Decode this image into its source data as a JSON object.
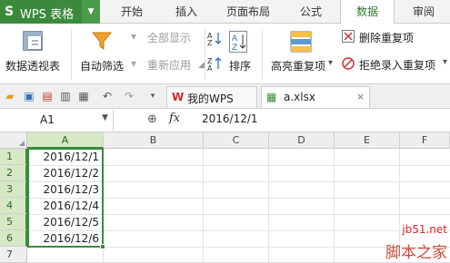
{
  "app": {
    "logo_glyph": "S",
    "name": "WPS 表格",
    "menu_caret": "▼"
  },
  "menu": {
    "tabs": [
      "开始",
      "插入",
      "页面布局",
      "公式",
      "数据",
      "审阅"
    ],
    "active_tab": "数据"
  },
  "ribbon": {
    "pivot_table": "数据透视表",
    "auto_filter": "自动筛选",
    "show_all": "全部显示",
    "reapply": "重新应用",
    "sort": "排序",
    "highlight_duplicates": "高亮重复项",
    "remove_duplicates": "删除重复项",
    "reject_duplicates": "拒绝录入重复项",
    "dropdown_caret": "▾"
  },
  "doc_tabs": [
    {
      "label": "我的WPS",
      "active": false
    },
    {
      "label": "a.xlsx",
      "active": true
    }
  ],
  "formula_bar": {
    "name_box": "A1",
    "fx_label": "fx",
    "value": "2016/12/1"
  },
  "grid": {
    "columns": [
      "A",
      "B",
      "C",
      "D",
      "E",
      "F"
    ],
    "rows": [
      "1",
      "2",
      "3",
      "4",
      "5",
      "6",
      "7"
    ],
    "selected_column": "A",
    "cells_A": [
      "2016/12/1",
      "2016/12/2",
      "2016/12/3",
      "2016/12/4",
      "2016/12/5",
      "2016/12/6"
    ]
  },
  "watermark": {
    "url": "jb51.net",
    "text": "脚本之家"
  },
  "colors": {
    "accent": "#3b8a3c",
    "selection_fill": "#d6e8c6"
  }
}
